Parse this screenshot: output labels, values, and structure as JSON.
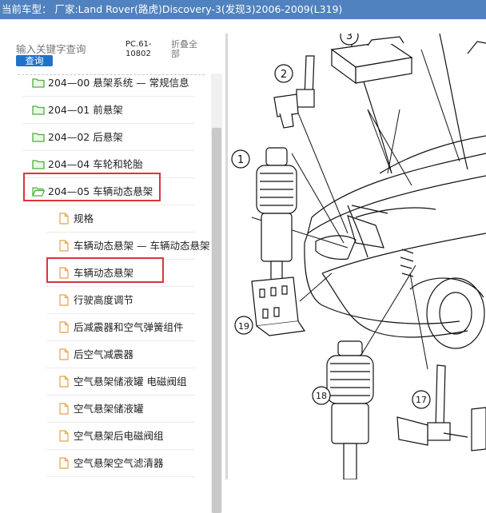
{
  "header": {
    "title": "当前车型： 厂家:Land Rover(路虎)Discovery-3(发现3)2006-2009(L319)"
  },
  "search": {
    "placeholder": "输入关键字查询",
    "button_label": "查询"
  },
  "pc_code": "PC.61-10802",
  "collapse_label": "折叠全部",
  "tree": {
    "folders": [
      {
        "label": "204—00 悬架系统 — 常规信息",
        "icon": "folder-icon"
      },
      {
        "label": "204—01 前悬架",
        "icon": "folder-icon"
      },
      {
        "label": "204—02 后悬架",
        "icon": "folder-icon"
      },
      {
        "label": "204—04 车轮和轮胎",
        "icon": "folder-icon"
      },
      {
        "label": "204—05 车辆动态悬架",
        "icon": "folder-open-icon",
        "expanded": true,
        "highlighted": true
      }
    ],
    "docs": [
      {
        "label": "规格"
      },
      {
        "label": "车辆动态悬架 — 车辆动态悬架"
      },
      {
        "label": "车辆动态悬架",
        "highlighted": true
      },
      {
        "label": "行驶高度调节"
      },
      {
        "label": "后减震器和空气弹簧组件"
      },
      {
        "label": "后空气减震器"
      },
      {
        "label": "空气悬架储液罐 电磁阀组"
      },
      {
        "label": "空气悬架储液罐"
      },
      {
        "label": "空气悬架后电磁阀组"
      },
      {
        "label": "空气悬架空气滤清器"
      }
    ]
  },
  "diagram": {
    "callouts": [
      "1",
      "2",
      "3",
      "17",
      "18",
      "19"
    ]
  },
  "colors": {
    "titlebar": "#4f82be",
    "folder_icon": "#4caf3c",
    "doc_icon": "#e8a14a",
    "highlight_border": "#d9363c",
    "search_button": "#1e73c8"
  }
}
